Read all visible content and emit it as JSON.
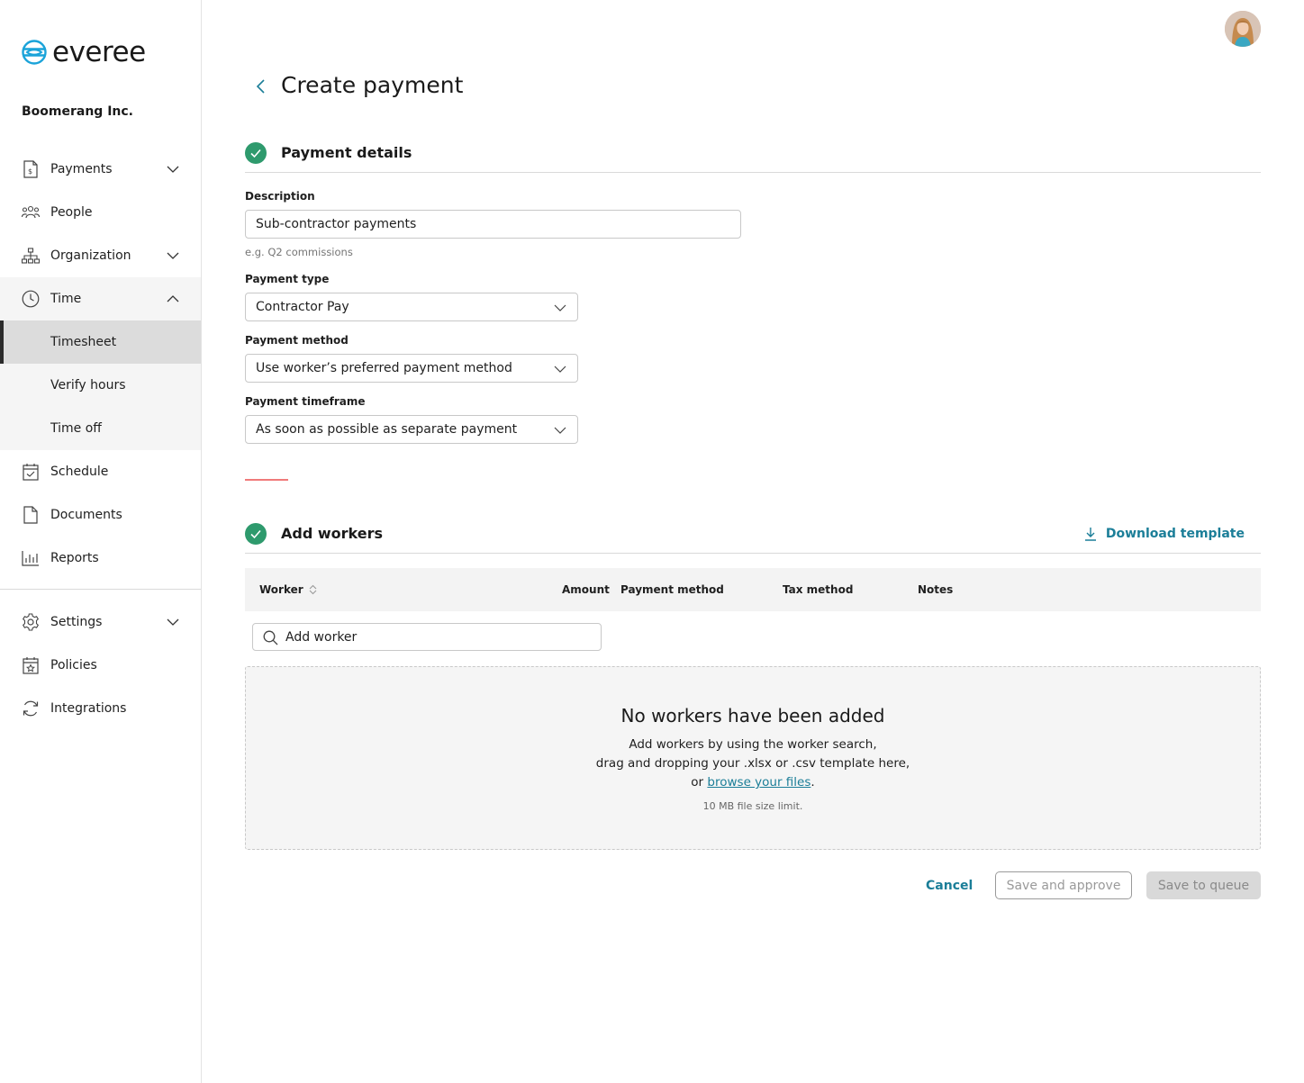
{
  "app": {
    "brand": "everee",
    "company": "Boomerang Inc.",
    "accent_color": "#1b7e98",
    "success_color": "#2e9a6d"
  },
  "sidebar": {
    "items": [
      {
        "label": "Payments",
        "icon": "receipt-icon",
        "expandable": true
      },
      {
        "label": "People",
        "icon": "people-icon",
        "expandable": false
      },
      {
        "label": "Organization",
        "icon": "org-chart-icon",
        "expandable": true
      },
      {
        "label": "Time",
        "icon": "clock-icon",
        "expandable": true,
        "expanded": true
      },
      {
        "label": "Schedule",
        "icon": "calendar-check-icon"
      },
      {
        "label": "Documents",
        "icon": "document-icon"
      },
      {
        "label": "Reports",
        "icon": "bar-chart-icon"
      }
    ],
    "time_subitems": [
      {
        "label": "Timesheet",
        "active": true
      },
      {
        "label": "Verify hours"
      },
      {
        "label": "Time off"
      }
    ],
    "bottom_items": [
      {
        "label": "Settings",
        "icon": "gear-icon",
        "expandable": true
      },
      {
        "label": "Policies",
        "icon": "policy-calendar-icon"
      },
      {
        "label": "Integrations",
        "icon": "sync-icon"
      }
    ]
  },
  "page": {
    "title": "Create payment"
  },
  "payment_details": {
    "title": "Payment details",
    "description_label": "Description",
    "description_value": "Sub-contractor payments",
    "description_hint": "e.g. Q2 commissions",
    "payment_type_label": "Payment type",
    "payment_type_value": "Contractor Pay",
    "payment_method_label": "Payment method",
    "payment_method_value": "Use worker’s preferred payment method",
    "payment_timeframe_label": "Payment timeframe",
    "payment_timeframe_value": "As soon as possible as separate payment"
  },
  "add_workers": {
    "title": "Add workers",
    "download_label": "Download template",
    "columns": [
      "Worker",
      "Amount",
      "Payment method",
      "Tax method",
      "Notes"
    ],
    "search_placeholder": "Add worker",
    "empty_title": "No workers have been added",
    "empty_line1": "Add workers by using the worker search,",
    "empty_line2": "drag and dropping your .xlsx or .csv template here,",
    "empty_line3_prefix": "or ",
    "empty_link": "browse your files",
    "empty_line3_suffix": ".",
    "size_limit": "10 MB file size limit."
  },
  "actions": {
    "cancel": "Cancel",
    "save_approve": "Save and approve",
    "save_queue": "Save to queue"
  }
}
